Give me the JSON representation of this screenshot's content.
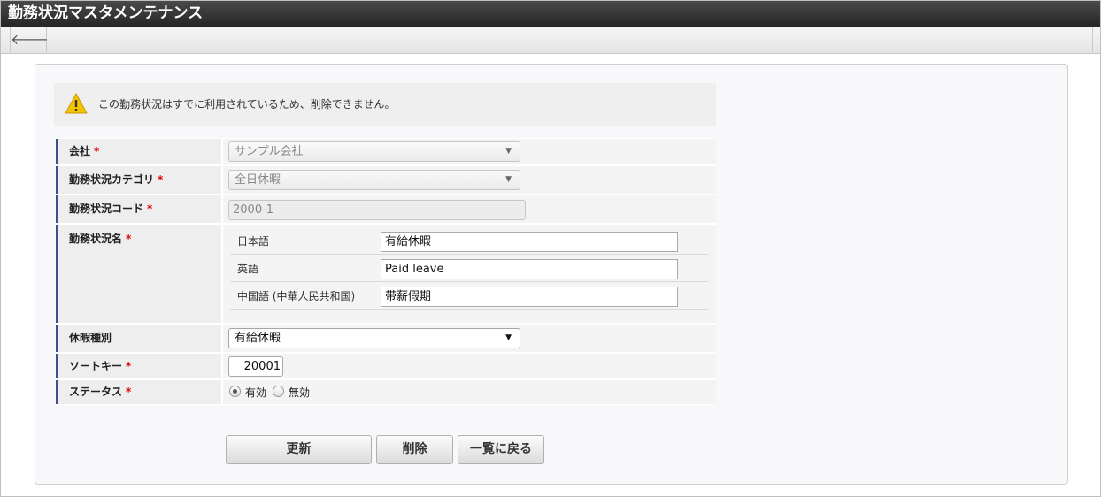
{
  "window": {
    "title": "勤務状況マスタメンテナンス"
  },
  "toolbar": {
    "back_icon": "left-arrow-icon",
    "back_glyph": "🡐"
  },
  "warning": {
    "icon": "warning-triangle-icon",
    "message": "この勤務状況はすでに利用されているため、削除できません。"
  },
  "form": {
    "company": {
      "label": "会社",
      "required": "*",
      "value": "サンプル会社"
    },
    "category": {
      "label": "勤務状況カテゴリ",
      "required": "*",
      "value": "全日休暇"
    },
    "code": {
      "label": "勤務状況コード",
      "required": "*",
      "value": "2000-1"
    },
    "name": {
      "label": "勤務状況名",
      "required": "*",
      "languages": [
        {
          "label": "日本語",
          "value": "有給休暇"
        },
        {
          "label": "英語",
          "value": "Paid leave"
        },
        {
          "label": "中国語 (中華人民共和国)",
          "value": "带薪假期"
        }
      ]
    },
    "leave_type": {
      "label": "休暇種別",
      "value": "有給休暇"
    },
    "sort_key": {
      "label": "ソートキー",
      "required": "*",
      "value": "20001"
    },
    "status": {
      "label": "ステータス",
      "required": "*",
      "options": [
        "有効",
        "無効"
      ],
      "selected": "有効"
    }
  },
  "buttons": {
    "update": "更新",
    "delete": "削除",
    "back_to_list": "一覧に戻る"
  },
  "colors": {
    "accent_bar": "#3f4e8c",
    "required_mark": "#e60000",
    "titlebar": "#2e2e2e"
  }
}
